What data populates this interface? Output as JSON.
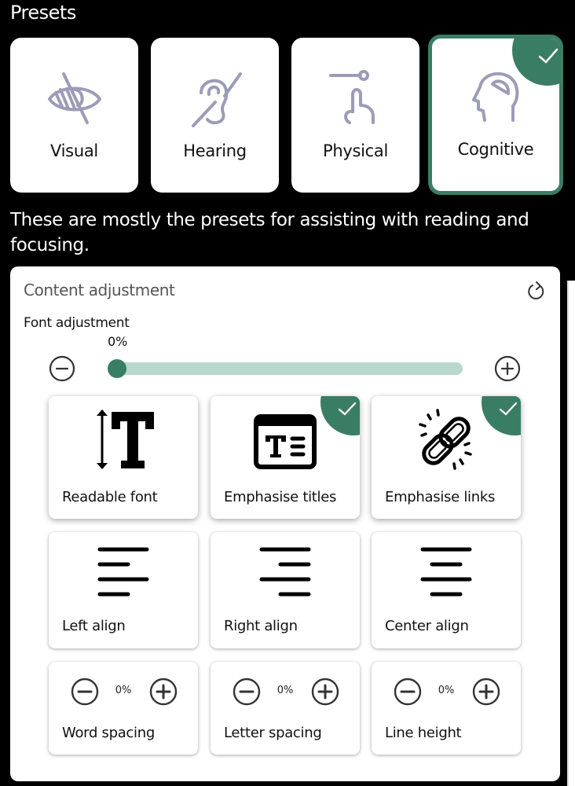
{
  "presets": {
    "title": "Presets",
    "items": [
      {
        "label": "Visual",
        "icon": "eye-slash-icon",
        "selected": false
      },
      {
        "label": "Hearing",
        "icon": "ear-slash-icon",
        "selected": false
      },
      {
        "label": "Physical",
        "icon": "hand-pointer-icon",
        "selected": false
      },
      {
        "label": "Cognitive",
        "icon": "head-brain-icon",
        "selected": true
      }
    ],
    "description": "These are mostly the presets for assisting with reading and focusing."
  },
  "content_adjustment": {
    "title": "Content adjustment",
    "reset_icon": "reset-icon",
    "font_adjustment": {
      "label": "Font adjustment",
      "value_text": "0%",
      "value_fraction": 0.0
    },
    "toggles": [
      {
        "label": "Readable font",
        "icon": "readable-font-icon",
        "selected": false
      },
      {
        "label": "Emphasise titles",
        "icon": "emphasise-titles-icon",
        "selected": true
      },
      {
        "label": "Emphasise links",
        "icon": "link-icon",
        "selected": true
      },
      {
        "label": "Left align",
        "icon": "align-left-icon",
        "selected": false
      },
      {
        "label": "Right align",
        "icon": "align-right-icon",
        "selected": false
      },
      {
        "label": "Center align",
        "icon": "align-center-icon",
        "selected": false
      }
    ],
    "steppers": [
      {
        "label": "Word spacing",
        "value": "0%"
      },
      {
        "label": "Letter spacing",
        "value": "0%"
      },
      {
        "label": "Line height",
        "value": "0%"
      }
    ]
  },
  "colors": {
    "accent": "#3a7d65",
    "slider_track": "#b7d8cd",
    "preset_icon": "#9c9cb8",
    "background": "#000000"
  }
}
